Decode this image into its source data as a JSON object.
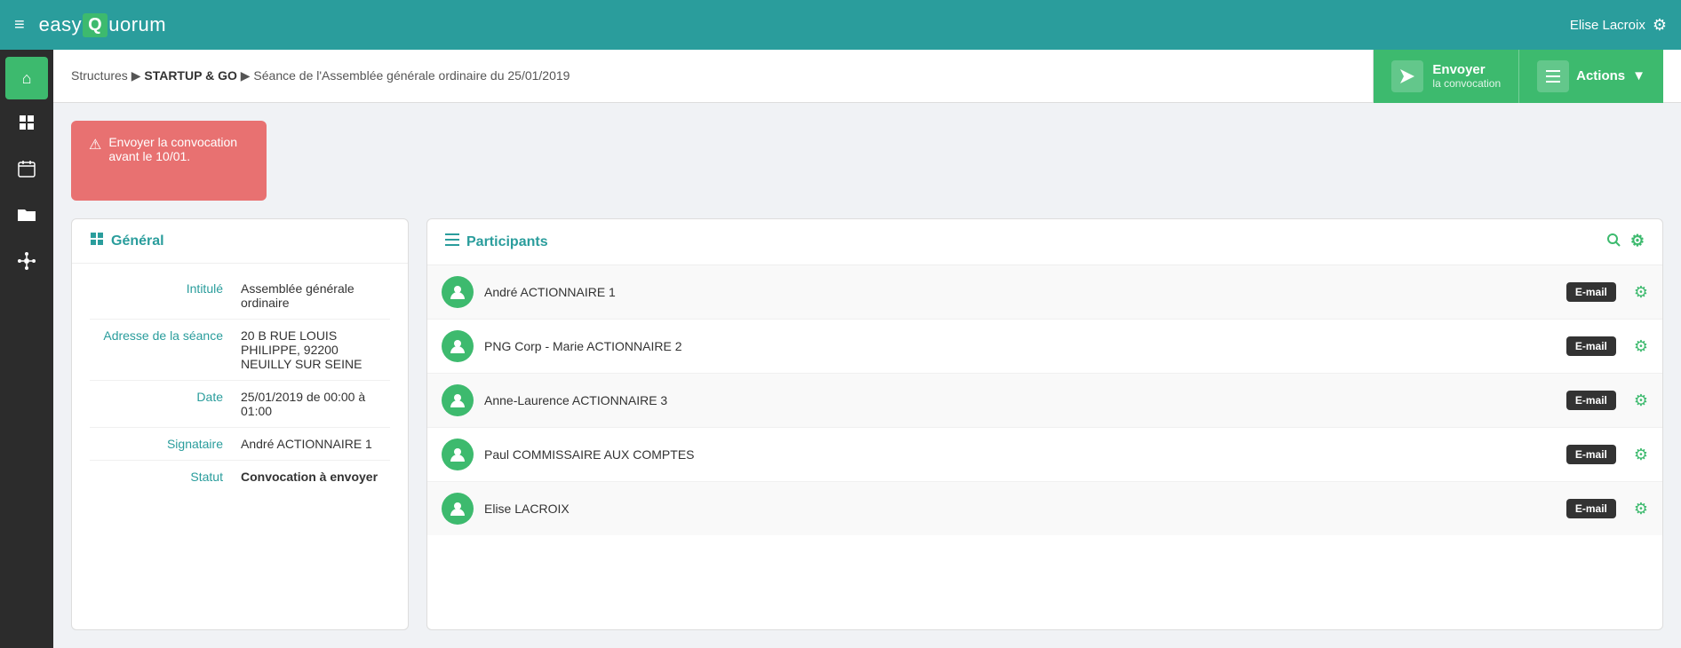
{
  "topbar": {
    "menu_icon": "≡",
    "logo_easy": "easy",
    "logo_q": "Q",
    "logo_uorum": "uorum",
    "user_name": "Elise Lacroix",
    "gear_icon": "⚙"
  },
  "sidebar": {
    "items": [
      {
        "id": "home",
        "icon": "⌂",
        "active": true
      },
      {
        "id": "building",
        "icon": "▦",
        "active": false
      },
      {
        "id": "calendar",
        "icon": "▦",
        "active": false
      },
      {
        "id": "folder",
        "icon": "▤",
        "active": false
      },
      {
        "id": "network",
        "icon": "⊞",
        "active": false
      }
    ]
  },
  "breadcrumb": {
    "part1": "Structures",
    "sep1": " ▶ ",
    "part2": "STARTUP & GO",
    "sep2": " ▶ ",
    "part3": "Séance de l'Assemblée générale ordinaire du 25/01/2019"
  },
  "actions_bar": {
    "envoyer_title": "Envoyer",
    "envoyer_sub": "la convocation",
    "actions_label": "Actions",
    "send_icon": "✈",
    "list_icon": "≡",
    "dropdown_arrow": "▼"
  },
  "alert": {
    "icon": "⚠",
    "message": "Envoyer la convocation avant le 10/01."
  },
  "general": {
    "header_icon": "▦",
    "title": "Général",
    "fields": [
      {
        "label": "Intitulé",
        "value": "Assemblée générale ordinaire",
        "bold": false
      },
      {
        "label": "Adresse de la séance",
        "value": "20 B RUE LOUIS PHILIPPE, 92200 NEUILLY SUR SEINE",
        "bold": false
      },
      {
        "label": "Date",
        "value": "25/01/2019 de 00:00 à 01:00",
        "bold": false
      },
      {
        "label": "Signataire",
        "value": "André ACTIONNAIRE 1",
        "bold": false
      },
      {
        "label": "Statut",
        "value": "Convocation à envoyer",
        "bold": true
      }
    ]
  },
  "participants": {
    "header_icon": "≡",
    "title": "Participants",
    "search_icon": "🔍",
    "gear_icon": "⚙",
    "items": [
      {
        "name": "André ACTIONNAIRE 1",
        "badge": "E-mail",
        "avatar_icon": "👤"
      },
      {
        "name": "PNG Corp - Marie ACTIONNAIRE 2",
        "badge": "E-mail",
        "avatar_icon": "👤"
      },
      {
        "name": "Anne-Laurence ACTIONNAIRE 3",
        "badge": "E-mail",
        "avatar_icon": "👤"
      },
      {
        "name": "Paul COMMISSAIRE AUX COMPTES",
        "badge": "E-mail",
        "avatar_icon": "👤"
      },
      {
        "name": "Elise LACROIX",
        "badge": "E-mail",
        "avatar_icon": "👤"
      }
    ]
  }
}
